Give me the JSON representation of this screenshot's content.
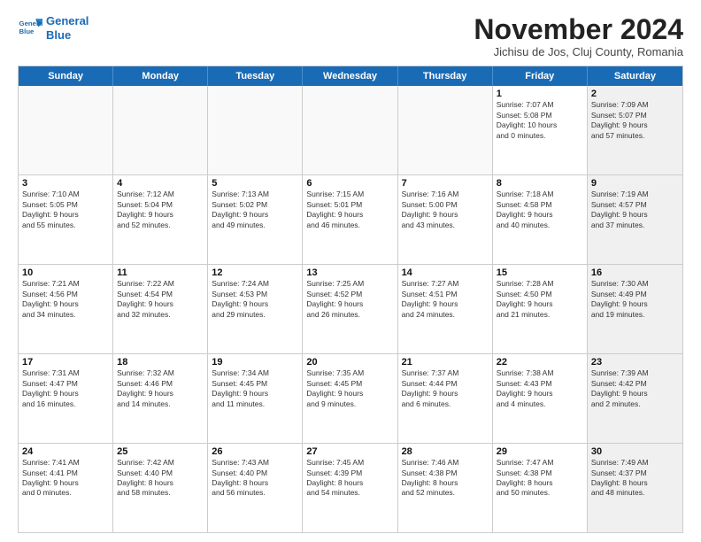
{
  "logo": {
    "line1": "General",
    "line2": "Blue"
  },
  "title": "November 2024",
  "subtitle": "Jichisu de Jos, Cluj County, Romania",
  "days_of_week": [
    "Sunday",
    "Monday",
    "Tuesday",
    "Wednesday",
    "Thursday",
    "Friday",
    "Saturday"
  ],
  "weeks": [
    [
      {
        "day": "",
        "detail": "",
        "empty": true
      },
      {
        "day": "",
        "detail": "",
        "empty": true
      },
      {
        "day": "",
        "detail": "",
        "empty": true
      },
      {
        "day": "",
        "detail": "",
        "empty": true
      },
      {
        "day": "",
        "detail": "",
        "empty": true
      },
      {
        "day": "1",
        "detail": "Sunrise: 7:07 AM\nSunset: 5:08 PM\nDaylight: 10 hours\nand 0 minutes.",
        "empty": false,
        "shaded": false
      },
      {
        "day": "2",
        "detail": "Sunrise: 7:09 AM\nSunset: 5:07 PM\nDaylight: 9 hours\nand 57 minutes.",
        "empty": false,
        "shaded": true
      }
    ],
    [
      {
        "day": "3",
        "detail": "Sunrise: 7:10 AM\nSunset: 5:05 PM\nDaylight: 9 hours\nand 55 minutes.",
        "empty": false,
        "shaded": false
      },
      {
        "day": "4",
        "detail": "Sunrise: 7:12 AM\nSunset: 5:04 PM\nDaylight: 9 hours\nand 52 minutes.",
        "empty": false,
        "shaded": false
      },
      {
        "day": "5",
        "detail": "Sunrise: 7:13 AM\nSunset: 5:02 PM\nDaylight: 9 hours\nand 49 minutes.",
        "empty": false,
        "shaded": false
      },
      {
        "day": "6",
        "detail": "Sunrise: 7:15 AM\nSunset: 5:01 PM\nDaylight: 9 hours\nand 46 minutes.",
        "empty": false,
        "shaded": false
      },
      {
        "day": "7",
        "detail": "Sunrise: 7:16 AM\nSunset: 5:00 PM\nDaylight: 9 hours\nand 43 minutes.",
        "empty": false,
        "shaded": false
      },
      {
        "day": "8",
        "detail": "Sunrise: 7:18 AM\nSunset: 4:58 PM\nDaylight: 9 hours\nand 40 minutes.",
        "empty": false,
        "shaded": false
      },
      {
        "day": "9",
        "detail": "Sunrise: 7:19 AM\nSunset: 4:57 PM\nDaylight: 9 hours\nand 37 minutes.",
        "empty": false,
        "shaded": true
      }
    ],
    [
      {
        "day": "10",
        "detail": "Sunrise: 7:21 AM\nSunset: 4:56 PM\nDaylight: 9 hours\nand 34 minutes.",
        "empty": false,
        "shaded": false
      },
      {
        "day": "11",
        "detail": "Sunrise: 7:22 AM\nSunset: 4:54 PM\nDaylight: 9 hours\nand 32 minutes.",
        "empty": false,
        "shaded": false
      },
      {
        "day": "12",
        "detail": "Sunrise: 7:24 AM\nSunset: 4:53 PM\nDaylight: 9 hours\nand 29 minutes.",
        "empty": false,
        "shaded": false
      },
      {
        "day": "13",
        "detail": "Sunrise: 7:25 AM\nSunset: 4:52 PM\nDaylight: 9 hours\nand 26 minutes.",
        "empty": false,
        "shaded": false
      },
      {
        "day": "14",
        "detail": "Sunrise: 7:27 AM\nSunset: 4:51 PM\nDaylight: 9 hours\nand 24 minutes.",
        "empty": false,
        "shaded": false
      },
      {
        "day": "15",
        "detail": "Sunrise: 7:28 AM\nSunset: 4:50 PM\nDaylight: 9 hours\nand 21 minutes.",
        "empty": false,
        "shaded": false
      },
      {
        "day": "16",
        "detail": "Sunrise: 7:30 AM\nSunset: 4:49 PM\nDaylight: 9 hours\nand 19 minutes.",
        "empty": false,
        "shaded": true
      }
    ],
    [
      {
        "day": "17",
        "detail": "Sunrise: 7:31 AM\nSunset: 4:47 PM\nDaylight: 9 hours\nand 16 minutes.",
        "empty": false,
        "shaded": false
      },
      {
        "day": "18",
        "detail": "Sunrise: 7:32 AM\nSunset: 4:46 PM\nDaylight: 9 hours\nand 14 minutes.",
        "empty": false,
        "shaded": false
      },
      {
        "day": "19",
        "detail": "Sunrise: 7:34 AM\nSunset: 4:45 PM\nDaylight: 9 hours\nand 11 minutes.",
        "empty": false,
        "shaded": false
      },
      {
        "day": "20",
        "detail": "Sunrise: 7:35 AM\nSunset: 4:45 PM\nDaylight: 9 hours\nand 9 minutes.",
        "empty": false,
        "shaded": false
      },
      {
        "day": "21",
        "detail": "Sunrise: 7:37 AM\nSunset: 4:44 PM\nDaylight: 9 hours\nand 6 minutes.",
        "empty": false,
        "shaded": false
      },
      {
        "day": "22",
        "detail": "Sunrise: 7:38 AM\nSunset: 4:43 PM\nDaylight: 9 hours\nand 4 minutes.",
        "empty": false,
        "shaded": false
      },
      {
        "day": "23",
        "detail": "Sunrise: 7:39 AM\nSunset: 4:42 PM\nDaylight: 9 hours\nand 2 minutes.",
        "empty": false,
        "shaded": true
      }
    ],
    [
      {
        "day": "24",
        "detail": "Sunrise: 7:41 AM\nSunset: 4:41 PM\nDaylight: 9 hours\nand 0 minutes.",
        "empty": false,
        "shaded": false
      },
      {
        "day": "25",
        "detail": "Sunrise: 7:42 AM\nSunset: 4:40 PM\nDaylight: 8 hours\nand 58 minutes.",
        "empty": false,
        "shaded": false
      },
      {
        "day": "26",
        "detail": "Sunrise: 7:43 AM\nSunset: 4:40 PM\nDaylight: 8 hours\nand 56 minutes.",
        "empty": false,
        "shaded": false
      },
      {
        "day": "27",
        "detail": "Sunrise: 7:45 AM\nSunset: 4:39 PM\nDaylight: 8 hours\nand 54 minutes.",
        "empty": false,
        "shaded": false
      },
      {
        "day": "28",
        "detail": "Sunrise: 7:46 AM\nSunset: 4:38 PM\nDaylight: 8 hours\nand 52 minutes.",
        "empty": false,
        "shaded": false
      },
      {
        "day": "29",
        "detail": "Sunrise: 7:47 AM\nSunset: 4:38 PM\nDaylight: 8 hours\nand 50 minutes.",
        "empty": false,
        "shaded": false
      },
      {
        "day": "30",
        "detail": "Sunrise: 7:49 AM\nSunset: 4:37 PM\nDaylight: 8 hours\nand 48 minutes.",
        "empty": false,
        "shaded": true
      }
    ]
  ]
}
